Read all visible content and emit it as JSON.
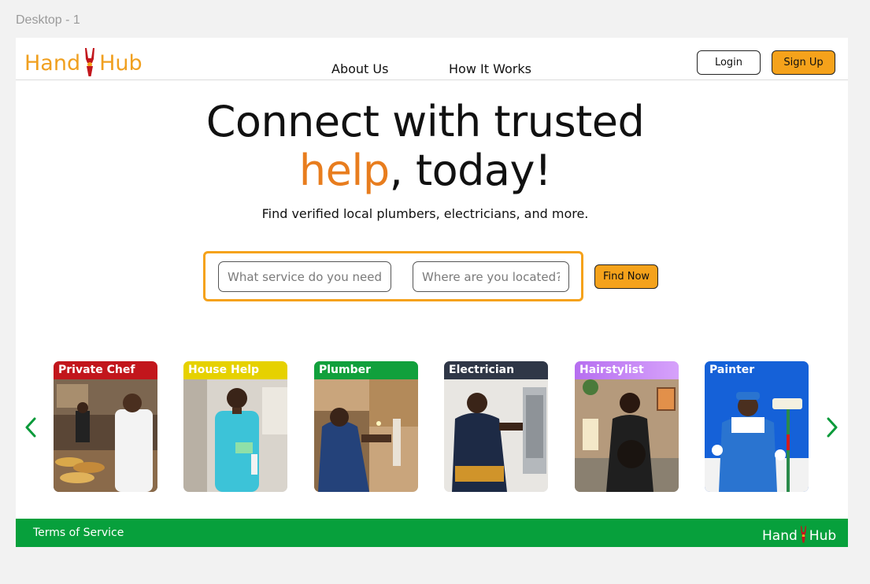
{
  "frame": {
    "label": "Desktop - 1"
  },
  "header": {
    "logo": {
      "left": "Hand",
      "right": "Hub",
      "icon": "pliers-icon"
    },
    "nav": [
      {
        "label": "About Us"
      },
      {
        "label": "How It Works"
      }
    ],
    "login_label": "Login",
    "signup_label": "Sign Up"
  },
  "hero": {
    "title_line1": "Connect with trusted",
    "title_accent": "help",
    "title_rest": ", today!",
    "subtitle": "Find verified local plumbers, electricians, and more."
  },
  "search": {
    "service_placeholder": "What service do you need?",
    "location_placeholder": "Where are you located?",
    "button_label": "Find Now"
  },
  "carousel": {
    "prev_icon": "chevron-left-icon",
    "next_icon": "chevron-right-icon",
    "cards": [
      {
        "label": "Private Chef",
        "color": "#c2161c"
      },
      {
        "label": "House Help",
        "color": "#e6d100"
      },
      {
        "label": "Plumber",
        "color": "#11a03c"
      },
      {
        "label": "Electrician",
        "color": "#2f3747"
      },
      {
        "label": "Hairstylist",
        "color": "#c084f5"
      },
      {
        "label": "Painter",
        "color": "#1561d8"
      }
    ]
  },
  "footer": {
    "terms_label": "Terms of Service",
    "logo": {
      "left": "Hand",
      "right": "Hub"
    }
  },
  "colors": {
    "brand_orange": "#f5a21b",
    "accent_orange": "#e87d1e",
    "footer_green": "#07a03c",
    "arrow_green": "#0a9a3a"
  }
}
